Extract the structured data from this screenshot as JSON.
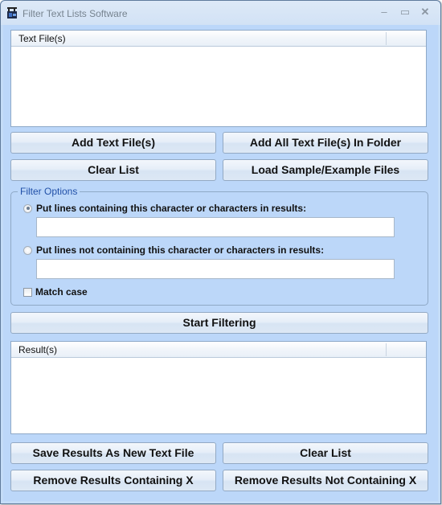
{
  "window": {
    "title": "Filter Text Lists Software",
    "controls": {
      "minimize": "–",
      "maximize": "▭",
      "close": "✕"
    }
  },
  "text_files_list": {
    "column_header": "Text File(s)",
    "items": []
  },
  "buttons_top": {
    "add_text_files": "Add Text File(s)",
    "add_all_in_folder": "Add All Text File(s) In Folder",
    "clear_list": "Clear List",
    "load_samples": "Load Sample/Example Files"
  },
  "filter_options": {
    "legend": "Filter Options",
    "option_containing": {
      "label": "Put lines containing this character or characters in results:",
      "selected": true,
      "value": "",
      "placeholder": ""
    },
    "option_not_containing": {
      "label": "Put lines not containing this character or characters in results:",
      "selected": false,
      "value": "",
      "placeholder": ""
    },
    "match_case": {
      "label": "Match case",
      "checked": false
    }
  },
  "start_filtering": "Start Filtering",
  "results_list": {
    "column_header": "Result(s)",
    "items": []
  },
  "buttons_bottom": {
    "save_results": "Save Results As New Text File",
    "clear_list": "Clear List",
    "remove_containing": "Remove Results Containing X",
    "remove_not_containing": "Remove Results Not Containing X"
  }
}
